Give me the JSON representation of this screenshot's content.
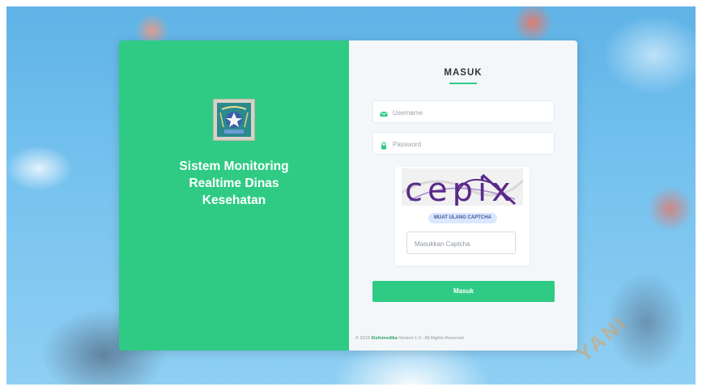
{
  "brand": {
    "logo_icon": "sleman-regency-emblem",
    "title_line1": "Sistem Monitoring",
    "title_line2": "Realtime Dinas",
    "title_line3": "Kesehatan"
  },
  "login": {
    "heading": "MASUK",
    "username_placeholder": "Username",
    "username_icon": "envelope-icon",
    "password_placeholder": "Password",
    "password_icon": "lock-icon",
    "captcha_text": "cepix",
    "captcha_reload_label": "MUAT ULANG CAPTCHA",
    "captcha_placeholder": "Masukkan Captcha",
    "submit_label": "Masuk"
  },
  "footer": {
    "prefix": "© 2019",
    "brand": "Sisfomedika",
    "suffix": "Version 1.0 - All Rights Reserved"
  },
  "watermark": "YANI",
  "colors": {
    "accent": "#2fcb84",
    "panel": "#f4f7fa",
    "background": "#76c2ef"
  }
}
